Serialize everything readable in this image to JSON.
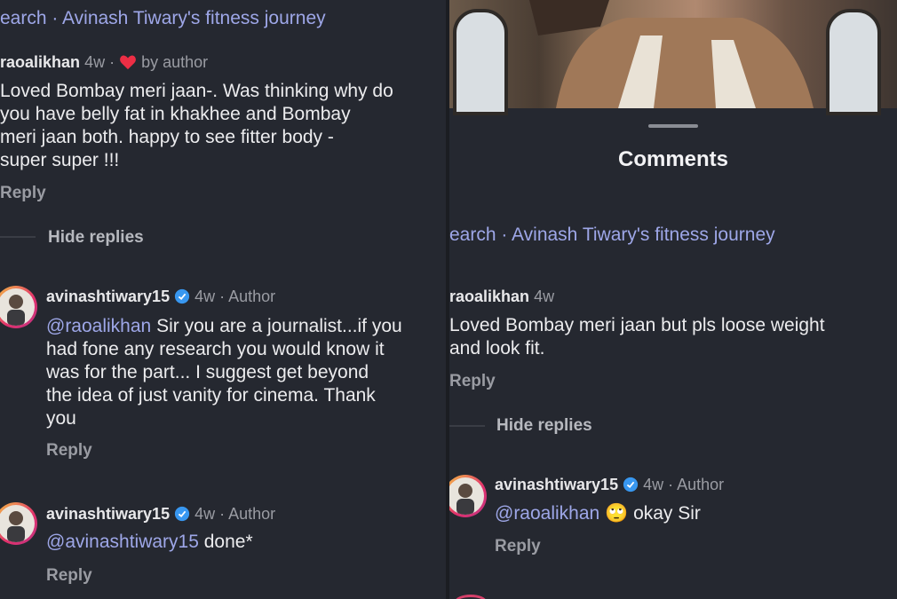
{
  "left": {
    "breadcrumb": "earch · Avinash Tiwary's fitness journey",
    "comment1": {
      "username": "raoalikhan",
      "time": "4w ·",
      "liked_by": "by author",
      "lines": [
        "Loved Bombay meri jaan-. Was thinking why do",
        "you  have belly fat in khakhee and Bombay",
        "meri jaan both.  happy to see fitter body -",
        "super super !!!"
      ],
      "reply": "Reply"
    },
    "hide_replies": "Hide replies",
    "reply1": {
      "username": "avinashtiwary15",
      "meta": "4w · Author",
      "mention": "@raoalikhan",
      "lines": [
        "Sir you are a journalist...if you",
        "had fone any research you would know it",
        "was for the part... I suggest get beyond",
        "the idea of just vanity for cinema. Thank",
        "you"
      ],
      "reply": "Reply"
    },
    "reply2": {
      "username": "avinashtiwary15",
      "meta": "4w · Author",
      "mention": "@avinashtiwary15",
      "text": "done*",
      "reply": "Reply"
    }
  },
  "right": {
    "sheet_title": "Comments",
    "breadcrumb": "earch · Avinash Tiwary's fitness journey",
    "comment1": {
      "username": "raoalikhan",
      "time": "4w",
      "lines": [
        "Loved Bombay meri jaan but pls loose weight",
        "and look fit."
      ],
      "reply": "Reply"
    },
    "hide_replies": "Hide replies",
    "reply1": {
      "username": "avinashtiwary15",
      "meta": "4w · Author",
      "mention": "@raoalikhan",
      "emoji": "🙄",
      "text": "okay Sir",
      "reply": "Reply"
    }
  },
  "colors": {
    "background": "#252830",
    "link": "#9ea7e8",
    "verified": "#3897f0",
    "heart": "#ed2e45"
  }
}
